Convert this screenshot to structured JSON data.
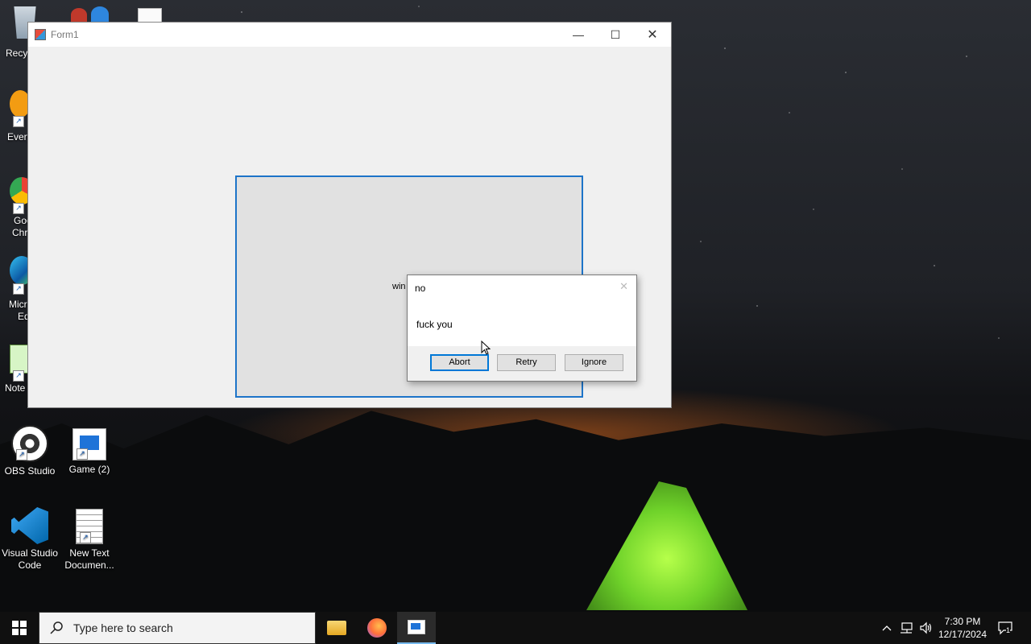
{
  "desktop": {
    "icons_partial": [
      {
        "label": "Recyc"
      },
      {
        "label": "Every"
      },
      {
        "label": "Goo"
      },
      {
        "label": "Chr"
      },
      {
        "label": "Micr"
      },
      {
        "label": "Ed"
      },
      {
        "label": "Note"
      }
    ],
    "icons": [
      {
        "label": "OBS Studio"
      },
      {
        "label": "Game (2)"
      },
      {
        "label_line1": "Visual Studio",
        "label_line2": "Code"
      },
      {
        "label_line1": "New Text",
        "label_line2": "Documen..."
      }
    ]
  },
  "window": {
    "title": "Form1",
    "min": "—",
    "max": "☐",
    "close": "✕",
    "panel_label": "win"
  },
  "msgbox": {
    "title": "no",
    "close": "✕",
    "message": "fuck you",
    "buttons": {
      "abort": "Abort",
      "retry": "Retry",
      "ignore": "Ignore"
    }
  },
  "taskbar": {
    "search_placeholder": "Type here to search",
    "time": "7:30 PM",
    "date": "12/17/2024",
    "notification_count": "1"
  },
  "colors": {
    "accent": "#0078d7",
    "panel_border": "#1d74c9",
    "taskbar": "#101010"
  }
}
